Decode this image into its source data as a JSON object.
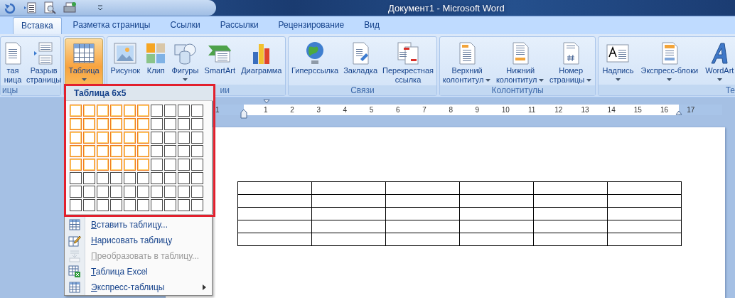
{
  "window": {
    "title": "Документ1 - Microsoft Word"
  },
  "tabs": [
    {
      "label": "Вставка",
      "selected": true
    },
    {
      "label": "Разметка страницы",
      "selected": false
    },
    {
      "label": "Ссылки",
      "selected": false
    },
    {
      "label": "Рассылки",
      "selected": false
    },
    {
      "label": "Рецензирование",
      "selected": false
    },
    {
      "label": "Вид",
      "selected": false
    }
  ],
  "ribbon": {
    "groups": [
      {
        "label": "ицы",
        "items": [
          {
            "lines": [
              "тая",
              "ница"
            ],
            "dropdown": false,
            "pressed": false
          },
          {
            "lines": [
              "Разрыв",
              "страницы"
            ],
            "dropdown": false,
            "pressed": false
          }
        ]
      },
      {
        "items": [
          {
            "lines": [
              "Таблица"
            ],
            "dropdown": true,
            "pressed": true
          }
        ]
      },
      {
        "label": "ии",
        "items": [
          {
            "lines": [
              "Рисунок"
            ],
            "dropdown": false,
            "pressed": false
          },
          {
            "lines": [
              "Клип"
            ],
            "dropdown": false,
            "pressed": false
          },
          {
            "lines": [
              "Фигуры"
            ],
            "dropdown": true,
            "pressed": false
          },
          {
            "lines": [
              "SmartArt"
            ],
            "dropdown": false,
            "pressed": false
          },
          {
            "lines": [
              "Диаграмма"
            ],
            "dropdown": false,
            "pressed": false
          }
        ]
      },
      {
        "label": "Связи",
        "items": [
          {
            "lines": [
              "Гиперссылка"
            ],
            "dropdown": false,
            "pressed": false
          },
          {
            "lines": [
              "Закладка"
            ],
            "dropdown": false,
            "pressed": false
          },
          {
            "lines": [
              "Перекрестная",
              "ссылка"
            ],
            "dropdown": false,
            "pressed": false
          }
        ]
      },
      {
        "label": "Колонтитулы",
        "items": [
          {
            "lines": [
              "Верхний",
              "колонтитул"
            ],
            "dropdown": true,
            "pressed": false
          },
          {
            "lines": [
              "Нижний",
              "колонтитул"
            ],
            "dropdown": true,
            "pressed": false
          },
          {
            "lines": [
              "Номер",
              "страницы"
            ],
            "dropdown": true,
            "pressed": false
          }
        ]
      },
      {
        "label": "Те",
        "items": [
          {
            "lines": [
              "Надпись"
            ],
            "dropdown": true,
            "pressed": false
          },
          {
            "lines": [
              "Экспресс-блоки"
            ],
            "dropdown": true,
            "pressed": false
          },
          {
            "lines": [
              "WordArt"
            ],
            "dropdown": true,
            "pressed": false
          }
        ]
      }
    ]
  },
  "ruler": {
    "marks": [
      "1",
      "1",
      "2",
      "3",
      "4",
      "5",
      "6",
      "7",
      "8",
      "9",
      "10",
      "11",
      "12",
      "13",
      "14",
      "15",
      "16",
      "17"
    ]
  },
  "table_menu": {
    "header": "Таблица 6x5",
    "grid": [
      {
        "cells": [
          {
            "selected": true
          },
          {
            "selected": true
          },
          {
            "selected": true
          },
          {
            "selected": true
          },
          {
            "selected": true
          },
          {
            "selected": true
          },
          {
            "selected": false
          },
          {
            "selected": false
          },
          {
            "selected": false
          },
          {
            "selected": false
          }
        ]
      },
      {
        "cells": [
          {
            "selected": true
          },
          {
            "selected": true
          },
          {
            "selected": true
          },
          {
            "selected": true
          },
          {
            "selected": true
          },
          {
            "selected": true
          },
          {
            "selected": false
          },
          {
            "selected": false
          },
          {
            "selected": false
          },
          {
            "selected": false
          }
        ]
      },
      {
        "cells": [
          {
            "selected": true
          },
          {
            "selected": true
          },
          {
            "selected": true
          },
          {
            "selected": true
          },
          {
            "selected": true
          },
          {
            "selected": true
          },
          {
            "selected": false
          },
          {
            "selected": false
          },
          {
            "selected": false
          },
          {
            "selected": false
          }
        ]
      },
      {
        "cells": [
          {
            "selected": true
          },
          {
            "selected": true
          },
          {
            "selected": true
          },
          {
            "selected": true
          },
          {
            "selected": true
          },
          {
            "selected": true
          },
          {
            "selected": false
          },
          {
            "selected": false
          },
          {
            "selected": false
          },
          {
            "selected": false
          }
        ]
      },
      {
        "cells": [
          {
            "selected": true
          },
          {
            "selected": true
          },
          {
            "selected": true
          },
          {
            "selected": true
          },
          {
            "selected": true
          },
          {
            "selected": true
          },
          {
            "selected": false
          },
          {
            "selected": false
          },
          {
            "selected": false
          },
          {
            "selected": false
          }
        ]
      },
      {
        "cells": [
          {
            "selected": false
          },
          {
            "selected": false
          },
          {
            "selected": false
          },
          {
            "selected": false
          },
          {
            "selected": false
          },
          {
            "selected": false
          },
          {
            "selected": false
          },
          {
            "selected": false
          },
          {
            "selected": false
          },
          {
            "selected": false
          }
        ]
      },
      {
        "cells": [
          {
            "selected": false
          },
          {
            "selected": false
          },
          {
            "selected": false
          },
          {
            "selected": false
          },
          {
            "selected": false
          },
          {
            "selected": false
          },
          {
            "selected": false
          },
          {
            "selected": false
          },
          {
            "selected": false
          },
          {
            "selected": false
          }
        ]
      },
      {
        "cells": [
          {
            "selected": false
          },
          {
            "selected": false
          },
          {
            "selected": false
          },
          {
            "selected": false
          },
          {
            "selected": false
          },
          {
            "selected": false
          },
          {
            "selected": false
          },
          {
            "selected": false
          },
          {
            "selected": false
          },
          {
            "selected": false
          }
        ]
      }
    ],
    "items": [
      {
        "label": "Вставить таблицу...",
        "disabled": false,
        "submenu": false
      },
      {
        "label": "Нарисовать таблицу",
        "disabled": false,
        "submenu": false
      },
      {
        "label": "Преобразовать в таблицу...",
        "disabled": true,
        "submenu": false
      },
      {
        "label": "Таблица Excel",
        "disabled": false,
        "submenu": false
      },
      {
        "label": "Экспресс-таблицы",
        "disabled": false,
        "submenu": true
      }
    ]
  }
}
